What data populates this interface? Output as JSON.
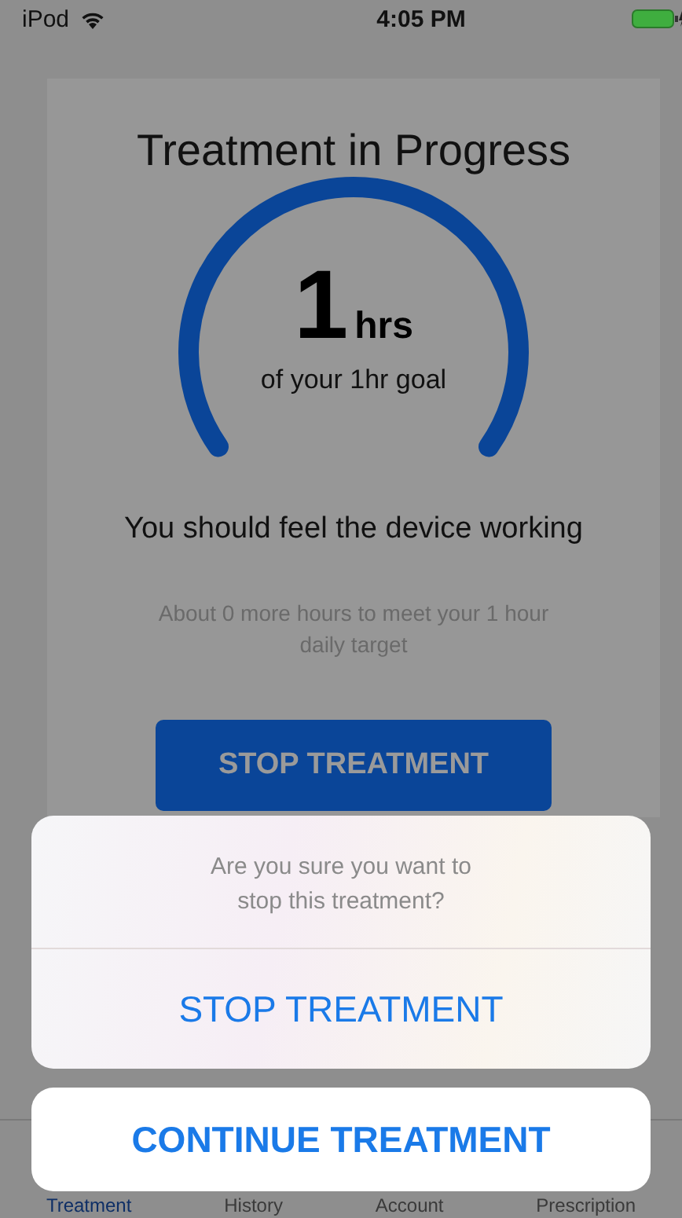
{
  "status_bar": {
    "carrier": "iPod",
    "time": "4:05 PM"
  },
  "treatment": {
    "title": "Treatment in Progress",
    "gauge": {
      "value": "1",
      "unit": "hrs",
      "caption": "of your 1hr goal"
    },
    "message": "You should feel the device working",
    "note": "About 0 more hours to meet your 1 hour daily target",
    "button": "STOP TREATMENT"
  },
  "tabs": [
    {
      "label": "Treatment",
      "selected": true
    },
    {
      "label": "History",
      "selected": false
    },
    {
      "label": "Account",
      "selected": false
    },
    {
      "label": "Prescription",
      "selected": false
    }
  ],
  "action_sheet": {
    "message": "Are you sure you want to stop this treatment?",
    "actions": [
      {
        "label": "STOP TREATMENT"
      }
    ],
    "cancel": "CONTINUE TREATMENT"
  }
}
